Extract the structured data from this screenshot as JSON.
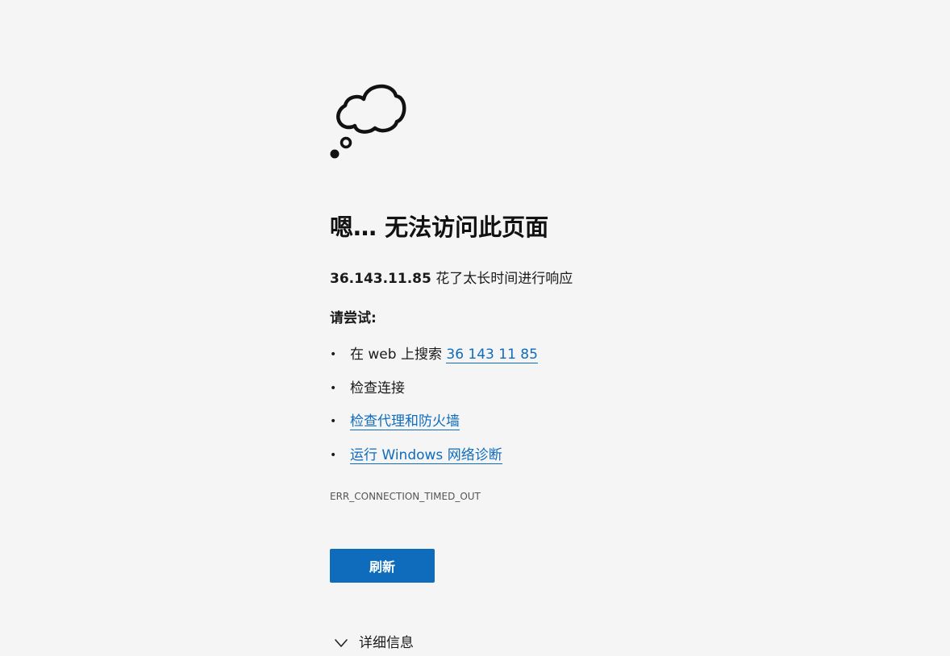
{
  "icon": "thought-cloud-icon",
  "title": "嗯… 无法访问此页面",
  "message": {
    "host": "36.143.11.85",
    "text": " 花了太长时间进行响应"
  },
  "try_heading": "请尝试:",
  "suggestions": [
    {
      "prefix": "在 web 上搜索 ",
      "link": "36 143 11 85"
    },
    {
      "prefix": "检查连接",
      "link": ""
    },
    {
      "prefix": "",
      "link": "检查代理和防火墙"
    },
    {
      "prefix": "",
      "link": "运行 Windows 网络诊断"
    }
  ],
  "bullet": "•",
  "error_code": "ERR_CONNECTION_TIMED_OUT",
  "refresh_label": "刷新",
  "details_label": "详细信息",
  "colors": {
    "background": "#f5f5f5",
    "accent": "#0f6cbd",
    "text": "#1a1a1a"
  }
}
